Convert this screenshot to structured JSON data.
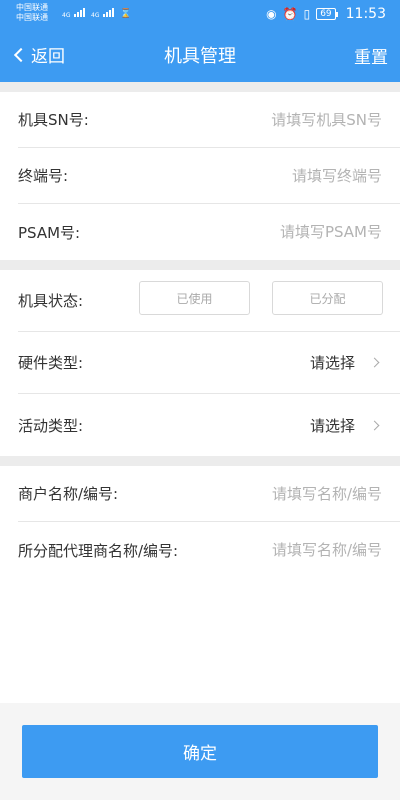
{
  "status_bar": {
    "carrier_1": "中国联通",
    "carrier_2": "中国联通",
    "net_1": "4G",
    "net_2": "4G",
    "battery": "69",
    "time": "11:53"
  },
  "header": {
    "back_label": "返回",
    "title": "机具管理",
    "reset_label": "重置"
  },
  "device_section": {
    "sn_label": "机具SN号:",
    "sn_placeholder": "请填写机具SN号",
    "terminal_label": "终端号:",
    "terminal_placeholder": "请填写终端号",
    "psam_label": "PSAM号:",
    "psam_placeholder": "请填写PSAM号"
  },
  "type_section": {
    "status_label": "机具状态:",
    "status_options": [
      "已使用",
      "已分配"
    ],
    "hardware_label": "硬件类型:",
    "hardware_value": "请选择",
    "activity_label": "活动类型:",
    "activity_value": "请选择"
  },
  "merchant_section": {
    "merchant_label": "商户名称/编号:",
    "merchant_placeholder": "请填写名称/编号",
    "agent_label": "所分配代理商名称/编号:",
    "agent_placeholder": "请填写名称/编号"
  },
  "footer": {
    "submit_label": "确定"
  },
  "colors": {
    "primary": "#3d9bf2",
    "separator": "#ececec",
    "placeholder": "#b3b3b3"
  },
  "icons": [
    "signal-icon",
    "hourglass-icon",
    "eye-icon",
    "alarm-icon",
    "vibrate-icon",
    "battery-icon",
    "chevron-left-icon",
    "chevron-right-icon"
  ]
}
